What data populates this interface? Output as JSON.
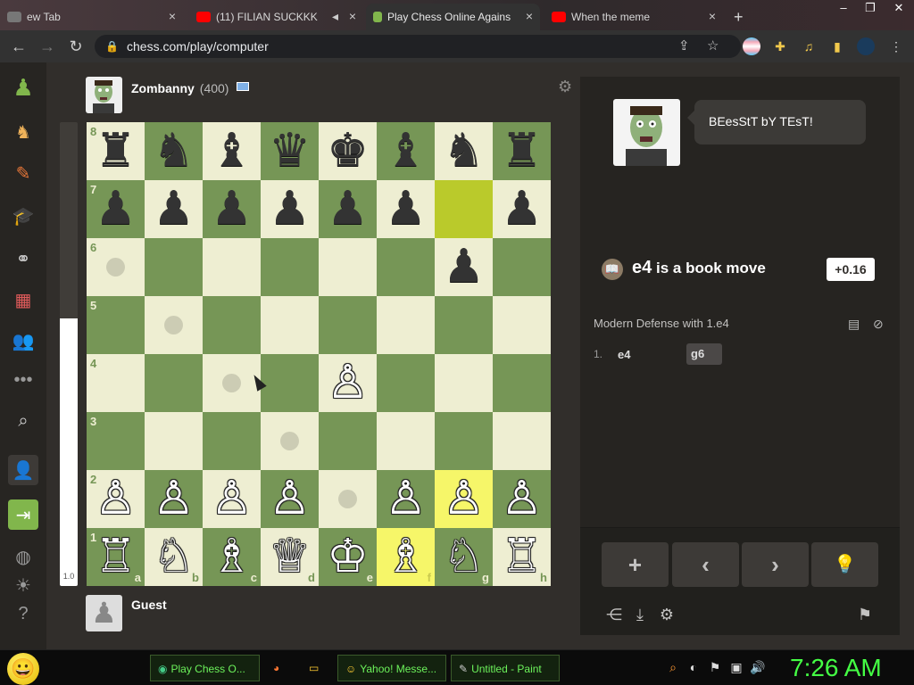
{
  "browser": {
    "tabs": [
      {
        "title": "ew Tab",
        "active": false
      },
      {
        "title": "(11) FILIAN SUCKKK",
        "active": false
      },
      {
        "title": "Play Chess Online Agains",
        "active": true
      },
      {
        "title": "When the meme",
        "active": false
      }
    ],
    "url": "chess.com/play/computer"
  },
  "top_player": {
    "name": "Zombanny",
    "rating": "(400)"
  },
  "bottom_player": {
    "name": "Guest"
  },
  "eval_bar_label": "1.0",
  "board": {
    "ranks": [
      "8",
      "7",
      "6",
      "5",
      "4",
      "3",
      "2",
      "1"
    ],
    "files": [
      "a",
      "b",
      "c",
      "d",
      "e",
      "f",
      "g",
      "h"
    ],
    "pieces": [
      [
        "♜",
        "♞",
        "♝",
        "♛",
        "♚",
        "♝",
        "♞",
        "♜"
      ],
      [
        "♟",
        "♟",
        "♟",
        "♟",
        "♟",
        "♟",
        "",
        "♟"
      ],
      [
        "",
        "",
        "",
        "",
        "",
        "",
        "♟",
        ""
      ],
      [
        "",
        "",
        "",
        "",
        "",
        "",
        "",
        ""
      ],
      [
        "",
        "",
        "",
        "",
        "♙",
        "",
        "",
        ""
      ],
      [
        "",
        "",
        "",
        "",
        "",
        "",
        "",
        ""
      ],
      [
        "♙",
        "♙",
        "♙",
        "♙",
        "",
        "♙",
        "♙",
        "♙"
      ],
      [
        "♖",
        "♘",
        "♗",
        "♕",
        "♔",
        "♗",
        "♘",
        "♖"
      ]
    ]
  },
  "coach": {
    "message": "BEesStT bY TEsT!"
  },
  "book_move": {
    "move": "e4",
    "text": "is a book move"
  },
  "evaluation": "+0.16",
  "opening": "Modern Defense with 1.e4",
  "moves": [
    {
      "number": "1.",
      "white": "e4",
      "black": "g6"
    }
  ],
  "controls": {
    "new": "+",
    "prev": "‹",
    "next": "›",
    "hint": "💡"
  },
  "taskbar": {
    "items": [
      "Play Chess O...",
      "Yahoo! Messe...",
      "Untitled - Paint"
    ],
    "clock": "7:26 AM"
  },
  "colors": {
    "light_square": "#eeeed2",
    "dark_square": "#769656",
    "highlight": "#f6f669",
    "accent_green": "#81b64c"
  }
}
